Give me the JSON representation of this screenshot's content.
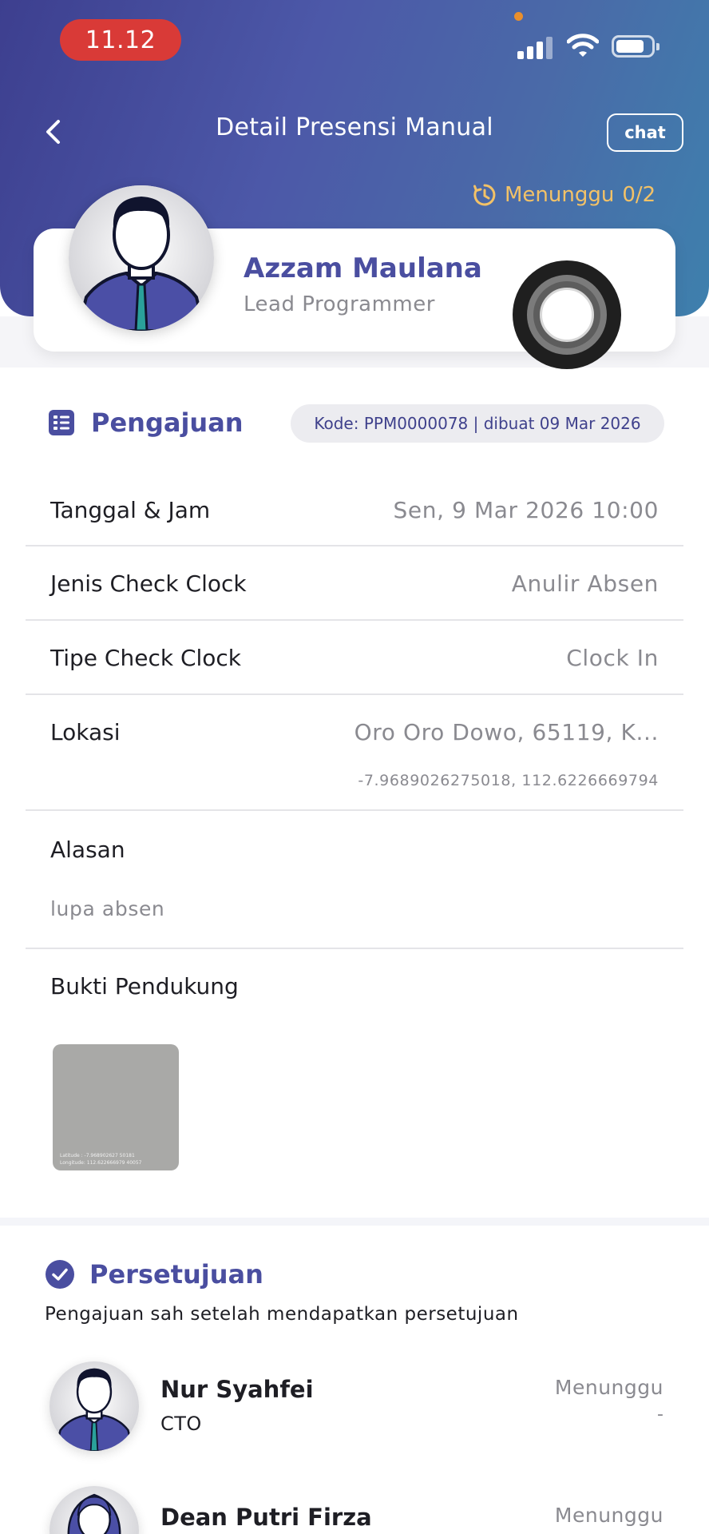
{
  "status_bar": {
    "time": "11.12"
  },
  "header": {
    "title": "Detail Presensi Manual",
    "chat_label": "chat",
    "status_label": "Menunggu",
    "status_count": "0/2",
    "status_color": "#f3c267"
  },
  "profile": {
    "name": "Azzam Maulana",
    "role": "Lead Programmer"
  },
  "submission": {
    "title": "Pengajuan",
    "code": "Kode: PPM0000078 | dibuat 09 Mar 2026",
    "rows": [
      {
        "label": "Tanggal & Jam",
        "value": "Sen, 9 Mar 2026 10:00"
      },
      {
        "label": "Jenis Check Clock",
        "value": "Anulir Absen"
      },
      {
        "label": "Tipe Check Clock",
        "value": "Clock In"
      },
      {
        "label": "Lokasi",
        "value": "Oro Oro Dowo, 65119, K...",
        "coords": "-7.9689026275018, 112.6226669794"
      }
    ],
    "reason_label": "Alasan",
    "reason_value": "lupa absen",
    "proof_label": "Bukti Pendukung",
    "proof_caption_1": "Latitude : -7.968902627 50181",
    "proof_caption_2": "Longitude: 112.622666979 40057"
  },
  "approval": {
    "title": "Persetujuan",
    "description": "Pengajuan sah setelah mendapatkan persetujuan",
    "approvers": [
      {
        "name": "Nur Syahfei",
        "role": "CTO",
        "status": "Menunggu",
        "date": "-"
      },
      {
        "name": "Dean Putri Firza",
        "role": "",
        "status": "Menunggu",
        "date": ""
      }
    ]
  },
  "colors": {
    "primary": "#4a4ea0",
    "header_start": "#3d3f8f",
    "header_end": "#3e80ad",
    "time_pill": "#d93a37"
  }
}
